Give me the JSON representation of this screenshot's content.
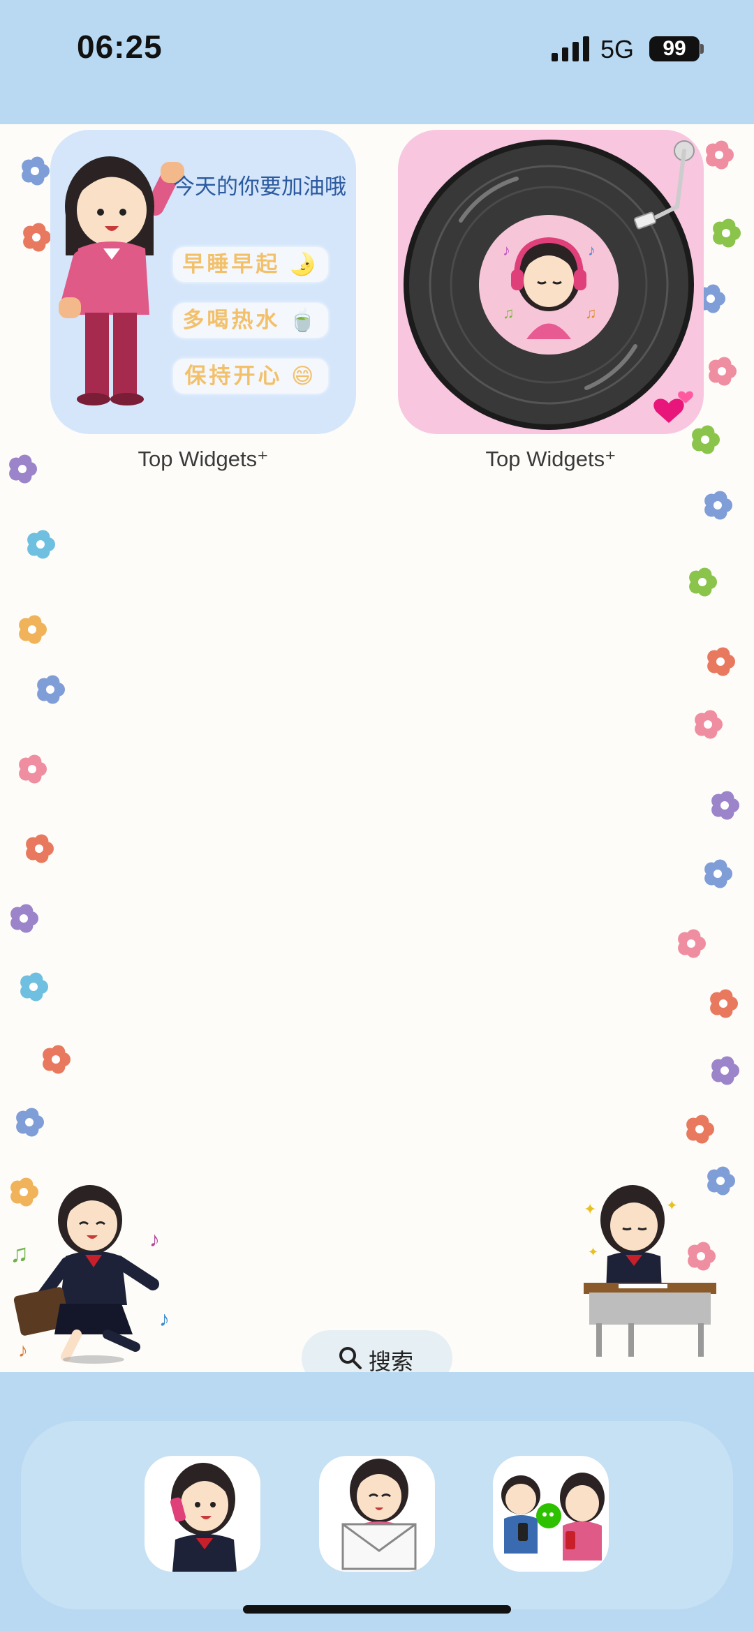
{
  "status_bar": {
    "time": "06:25",
    "network": "5G",
    "battery": "99"
  },
  "widgets": [
    {
      "caption": "Top Widgets⁺",
      "motto": "今天的你要加油哦",
      "reminders": [
        "早睡早起 🌛",
        "多喝热水 🍵",
        "保持开心 😄"
      ]
    },
    {
      "caption": "Top Widgets⁺"
    }
  ],
  "search": {
    "label": "搜索",
    "icon": "search-icon"
  },
  "dock": {
    "apps": [
      "phone-app-icon",
      "mail-app-icon",
      "wechat-app-icon"
    ]
  },
  "colors": {
    "band": "#b9d9f2",
    "wallpaper": "#fdfcf8",
    "widget_blue": "#d5e6fb",
    "widget_pink": "#f8c6df"
  }
}
